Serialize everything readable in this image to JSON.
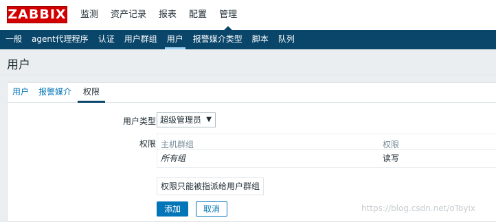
{
  "header": {
    "logo": "ZABBIX",
    "menu": [
      {
        "label": "监测",
        "selected": false
      },
      {
        "label": "资产记录",
        "selected": false
      },
      {
        "label": "报表",
        "selected": false
      },
      {
        "label": "配置",
        "selected": false
      },
      {
        "label": "管理",
        "selected": true
      }
    ]
  },
  "submenu": [
    {
      "label": "一般",
      "selected": false
    },
    {
      "label": "agent代理程序",
      "selected": false
    },
    {
      "label": "认证",
      "selected": false
    },
    {
      "label": "用户群组",
      "selected": false
    },
    {
      "label": "用户",
      "selected": true
    },
    {
      "label": "报警媒介类型",
      "selected": false
    },
    {
      "label": "脚本",
      "selected": false
    },
    {
      "label": "队列",
      "selected": false
    }
  ],
  "page": {
    "title": "用户"
  },
  "tabs": [
    {
      "label": "用户",
      "selected": false
    },
    {
      "label": "报警媒介",
      "selected": false
    },
    {
      "label": "权限",
      "selected": true
    }
  ],
  "form": {
    "user_type_label": "用户类型",
    "user_type_value": "超级管理员",
    "permissions_label": "权限",
    "permissions_table": {
      "headers": [
        "主机群组",
        "权限"
      ],
      "rows": [
        [
          "所有组",
          "读写"
        ]
      ]
    },
    "note": "权限只能被指派给用户群组",
    "add_button": "添加",
    "cancel_button": "取消"
  },
  "watermark": "https://blog.csdn.net/oToyix",
  "colors": {
    "logo_bg": "#d40000",
    "submenu_bg": "#0a466a",
    "link": "#0275b8",
    "primary_button": "#0275b8"
  }
}
